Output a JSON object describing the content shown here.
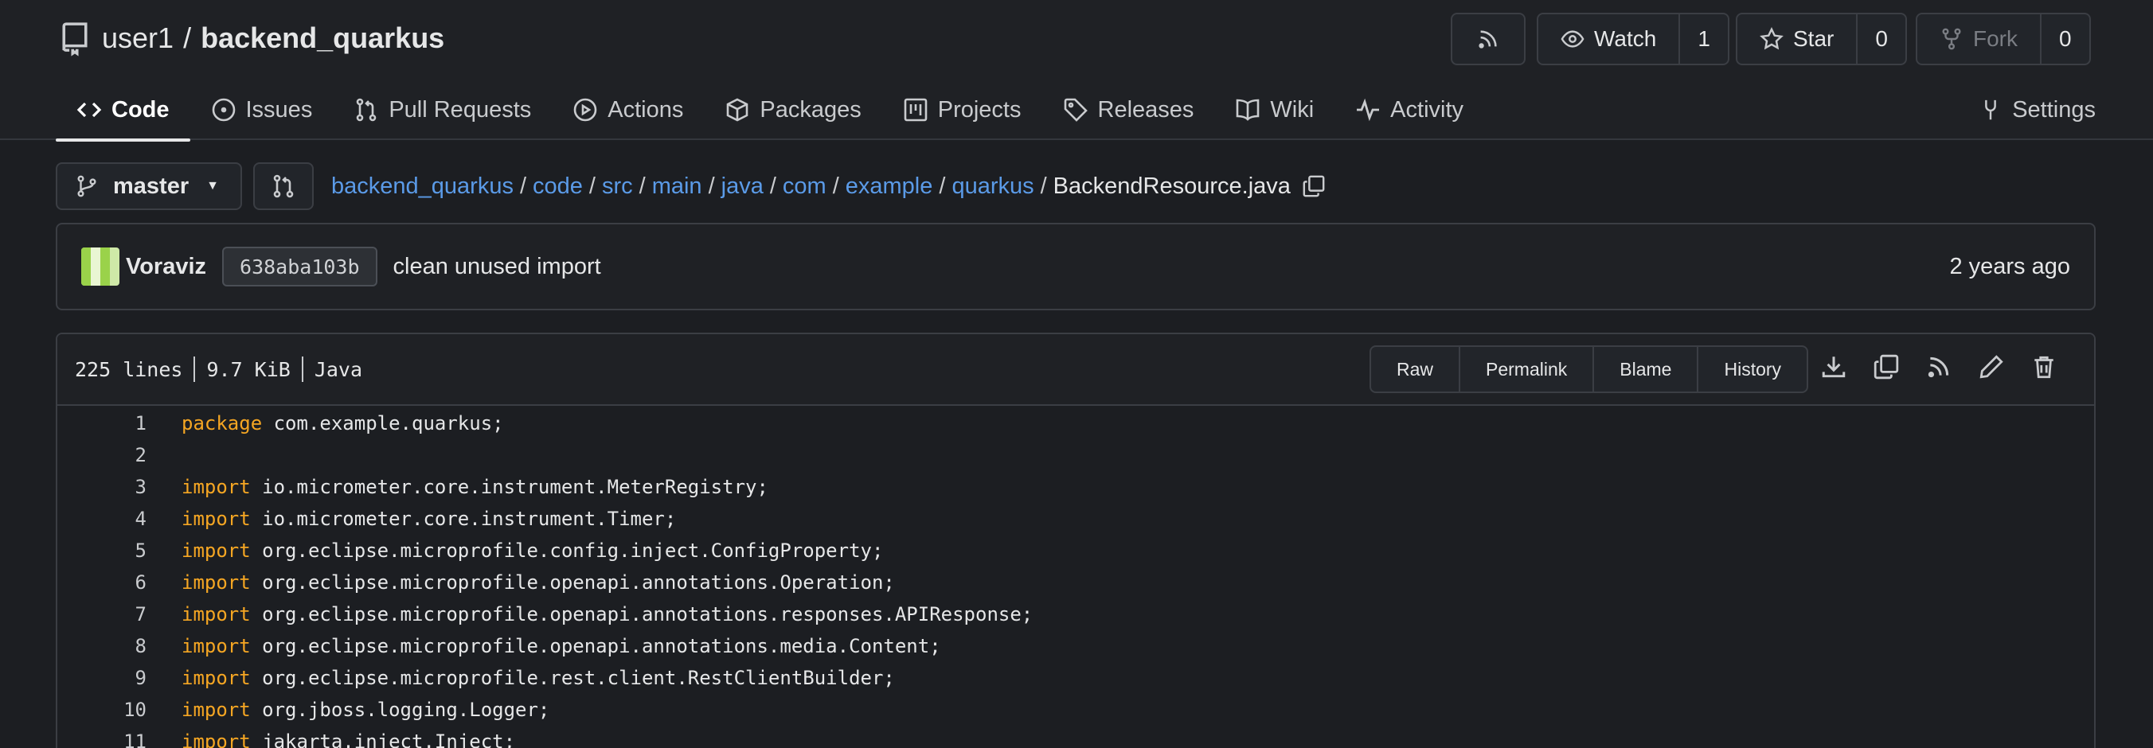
{
  "repo": {
    "owner": "user1",
    "separator": "/",
    "name": "backend_quarkus"
  },
  "header_buttons": {
    "watch_label": "Watch",
    "watch_count": "1",
    "star_label": "Star",
    "star_count": "0",
    "fork_label": "Fork",
    "fork_count": "0"
  },
  "tabs": [
    {
      "label": "Code",
      "icon": "code-icon"
    },
    {
      "label": "Issues",
      "icon": "issue-icon"
    },
    {
      "label": "Pull Requests",
      "icon": "pull-request-icon"
    },
    {
      "label": "Actions",
      "icon": "play-icon"
    },
    {
      "label": "Packages",
      "icon": "package-icon"
    },
    {
      "label": "Projects",
      "icon": "project-icon"
    },
    {
      "label": "Releases",
      "icon": "tag-icon"
    },
    {
      "label": "Wiki",
      "icon": "book-icon"
    },
    {
      "label": "Activity",
      "icon": "pulse-icon"
    }
  ],
  "settings_label": "Settings",
  "branch": {
    "name": "master"
  },
  "breadcrumb": {
    "parts": [
      "backend_quarkus",
      "code",
      "src",
      "main",
      "java",
      "com",
      "example",
      "quarkus"
    ],
    "separator": "/",
    "file": "BackendResource.java"
  },
  "commit": {
    "author": "Voraviz",
    "sha": "638aba103b",
    "message": "clean unused import",
    "time": "2 years ago"
  },
  "file": {
    "lines": "225 lines",
    "size": "9.7 KiB",
    "language": "Java",
    "buttons": [
      "Raw",
      "Permalink",
      "Blame",
      "History"
    ]
  },
  "code_lines": [
    {
      "num": "1",
      "kw": "package",
      "rest": " com.example.quarkus;"
    },
    {
      "num": "2",
      "kw": "",
      "rest": ""
    },
    {
      "num": "3",
      "kw": "import",
      "rest": " io.micrometer.core.instrument.MeterRegistry;"
    },
    {
      "num": "4",
      "kw": "import",
      "rest": " io.micrometer.core.instrument.Timer;"
    },
    {
      "num": "5",
      "kw": "import",
      "rest": " org.eclipse.microprofile.config.inject.ConfigProperty;"
    },
    {
      "num": "6",
      "kw": "import",
      "rest": " org.eclipse.microprofile.openapi.annotations.Operation;"
    },
    {
      "num": "7",
      "kw": "import",
      "rest": " org.eclipse.microprofile.openapi.annotations.responses.APIResponse;"
    },
    {
      "num": "8",
      "kw": "import",
      "rest": " org.eclipse.microprofile.openapi.annotations.media.Content;"
    },
    {
      "num": "9",
      "kw": "import",
      "rest": " org.eclipse.microprofile.rest.client.RestClientBuilder;"
    },
    {
      "num": "10",
      "kw": "import",
      "rest": " org.jboss.logging.Logger;"
    },
    {
      "num": "11",
      "kw": "import",
      "rest": " jakarta.inject.Inject;"
    }
  ],
  "colors": {
    "link": "#5b9be8",
    "keyword": "#f5a623",
    "background": "#1c1e22"
  }
}
